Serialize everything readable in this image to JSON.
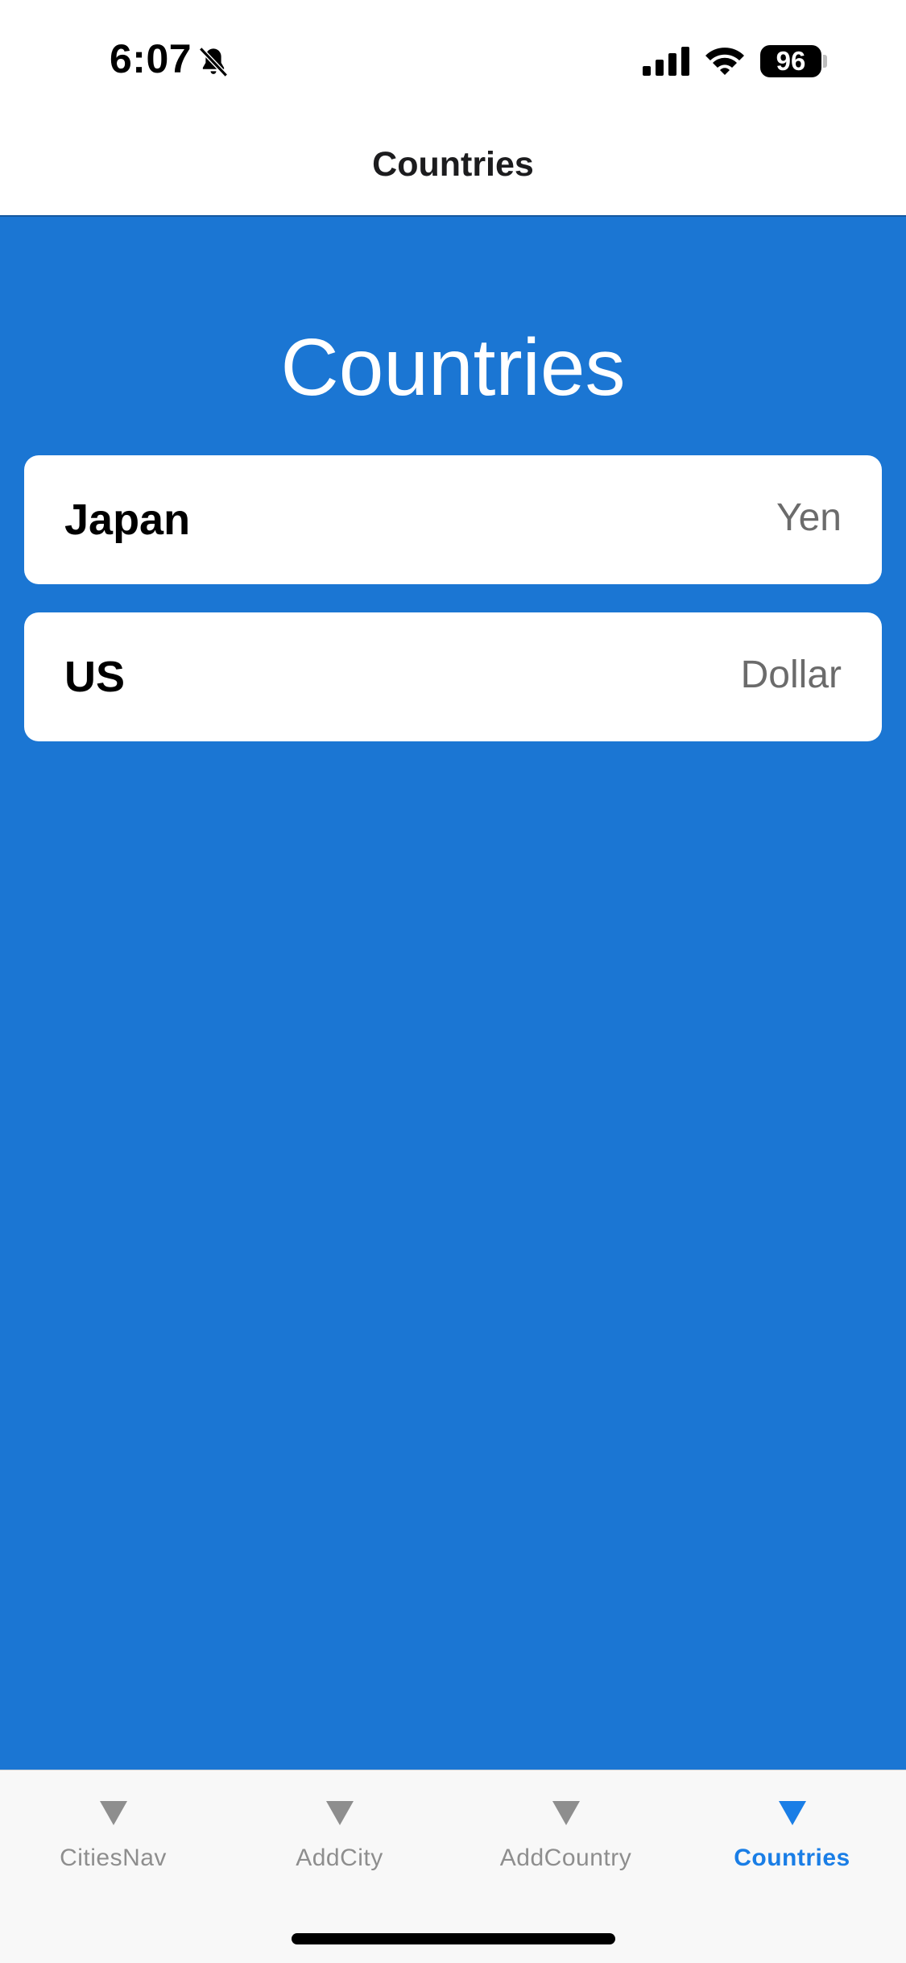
{
  "status_bar": {
    "time": "6:07",
    "battery_level": "96",
    "icons": [
      "bell-slash-icon",
      "cellular-signal-icon",
      "wifi-icon",
      "battery-icon"
    ]
  },
  "nav_bar": {
    "title": "Countries"
  },
  "main": {
    "heading": "Countries",
    "background_color": "#1b76d3",
    "countries": [
      {
        "name": "Japan",
        "currency": "Yen"
      },
      {
        "name": "US",
        "currency": "Dollar"
      }
    ]
  },
  "tab_bar": {
    "active_color": "#1a7ee6",
    "inactive_color": "#8e8e8e",
    "tabs": [
      {
        "label": "CitiesNav",
        "icon": "triangle-down-icon",
        "active": false
      },
      {
        "label": "AddCity",
        "icon": "triangle-down-icon",
        "active": false
      },
      {
        "label": "AddCountry",
        "icon": "triangle-down-icon",
        "active": false
      },
      {
        "label": "Countries",
        "icon": "triangle-down-icon",
        "active": true
      }
    ]
  }
}
